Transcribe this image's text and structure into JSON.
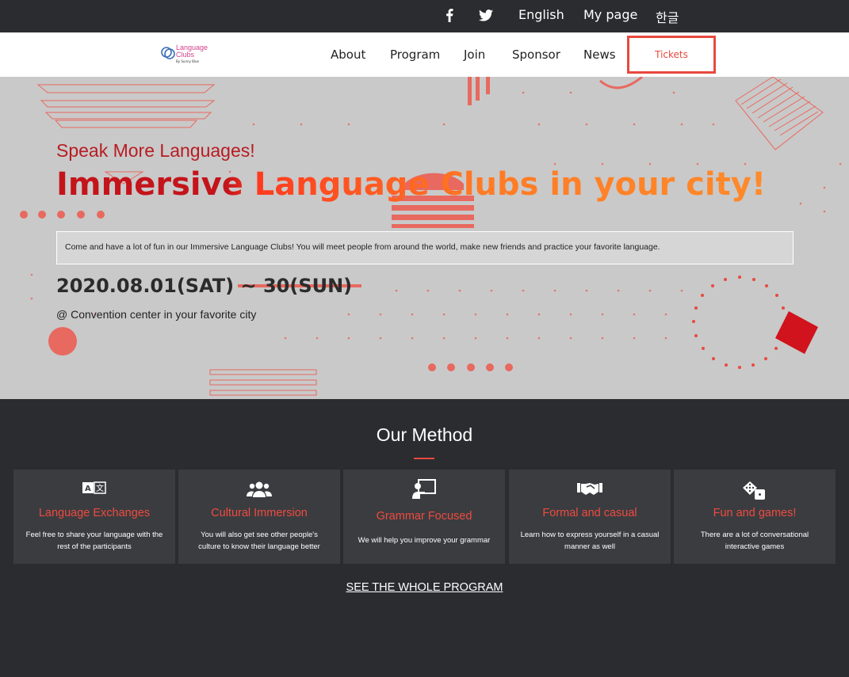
{
  "topbar": {
    "facebook_icon": "facebook-icon",
    "twitter_icon": "twitter-icon",
    "language": "English",
    "mypage": "My page",
    "korean": "한글"
  },
  "nav": {
    "logo_line1": "Language",
    "logo_line2": "Clubs",
    "logo_sub": "By Sunny Blue",
    "items": [
      "About",
      "Program",
      "Join",
      "Sponsor",
      "News"
    ],
    "tickets": "Tickets",
    "accent": "#e8493f"
  },
  "hero": {
    "subtitle": "Speak More Languages!",
    "title": "Immersive Language Clubs in your city!",
    "description": "Come and have a lot of fun in our Immersive Language Clubs! You will meet people from around the world, make new friends and practice your favorite language.",
    "date": "2020.08.01(SAT) ~ 30(SUN)",
    "location": "@ Convention center in your favorite city"
  },
  "method": {
    "title": "Our Method",
    "cards": [
      {
        "icon": "translate-icon",
        "title": "Language Exchanges",
        "desc": "Feel free to share your language with the rest of the participants"
      },
      {
        "icon": "users-icon",
        "title": "Cultural Immersion",
        "desc": "You will also get see other people's culture to know their language better"
      },
      {
        "icon": "teacher-icon",
        "title": "Grammar Focused",
        "desc": "We will help you improve your grammar"
      },
      {
        "icon": "handshake-icon",
        "title": "Formal and casual",
        "desc": "Learn how to express yourself in a casual manner as well"
      },
      {
        "icon": "dice-icon",
        "title": "Fun and games!",
        "desc": "There are a lot of conversational interactive games"
      }
    ],
    "see_all": "SEE THE WHOLE PROGRAM"
  }
}
